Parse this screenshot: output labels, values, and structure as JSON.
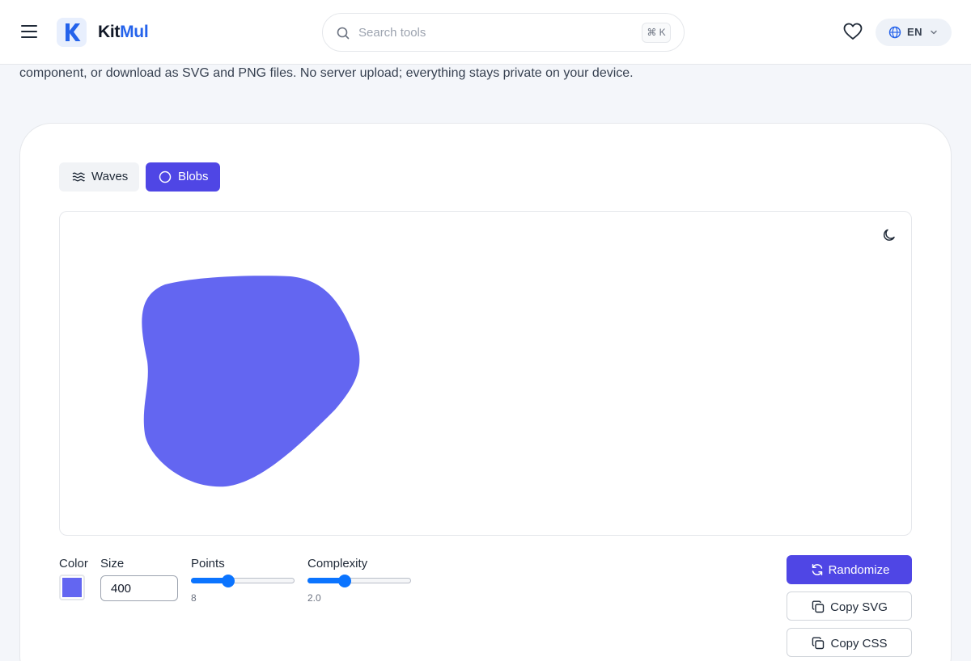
{
  "header": {
    "logo_letter": "K",
    "logo_kit": "Kit",
    "logo_mul": "Mul",
    "search_placeholder": "Search tools",
    "search_shortcut": "⌘ K",
    "language": "EN",
    "accent_color": "#2563eb"
  },
  "intro": {
    "text": "component, or download as SVG and PNG files. No server upload; everything stays private on your device."
  },
  "tabs": [
    {
      "label": "Waves",
      "icon": "waves-icon",
      "active": false
    },
    {
      "label": "Blobs",
      "icon": "circle-icon",
      "active": true
    }
  ],
  "preview": {
    "blob_color": "#6366f1",
    "theme_toggle_icon": "moon-icon"
  },
  "controls": {
    "color_label": "Color",
    "color_value": "#6366f1",
    "size_label": "Size",
    "size_value": "400",
    "points_label": "Points",
    "points_value": "8",
    "points_fraction": 0.36,
    "complexity_label": "Complexity",
    "complexity_value": "2.0",
    "complexity_fraction": 0.36
  },
  "actions": {
    "randomize": "Randomize",
    "copy_svg": "Copy SVG",
    "copy_css": "Copy CSS",
    "primary_color": "#4f46e5"
  }
}
